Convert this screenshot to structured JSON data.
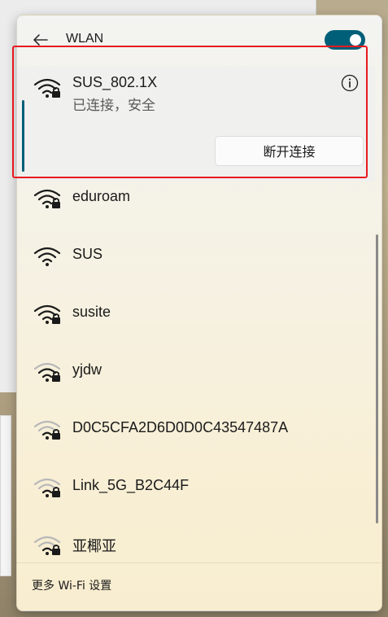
{
  "panel": {
    "title": "WLAN",
    "wifi_enabled": true
  },
  "connected": {
    "name": "SUS_802.1X",
    "status": "已连接，安全",
    "secured": true,
    "disconnect_label": "断开连接"
  },
  "networks": [
    {
      "name": "eduroam",
      "secured": true,
      "signal": "strong"
    },
    {
      "name": "SUS",
      "secured": false,
      "signal": "strong"
    },
    {
      "name": "susite",
      "secured": true,
      "signal": "strong"
    },
    {
      "name": "yjdw",
      "secured": true,
      "signal": "medium"
    },
    {
      "name": "D0C5CFA2D6D0D0C43547487A",
      "secured": true,
      "signal": "weak"
    },
    {
      "name": "Link_5G_B2C44F",
      "secured": true,
      "signal": "weak"
    },
    {
      "name": "亚椰亚",
      "secured": true,
      "signal": "weak"
    }
  ],
  "footer": {
    "more_settings": "更多 Wi-Fi 设置"
  },
  "colors": {
    "accent": "#005f78",
    "highlight": "#e8191f"
  }
}
